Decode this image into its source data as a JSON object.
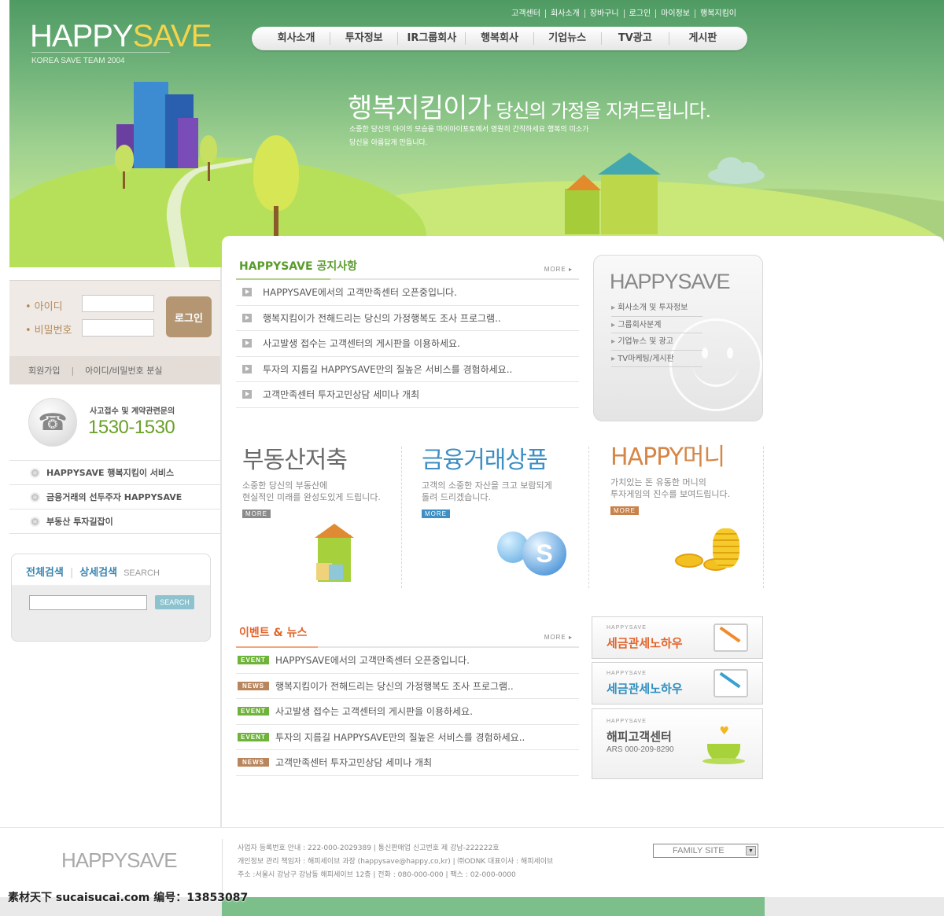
{
  "header": {
    "logo_happy": "HAPPY",
    "logo_save": "SAVE",
    "logo_sub": "KOREA SAVE TEAM 2004",
    "util_links": [
      "고객센터",
      "회사소개",
      "장바구니",
      "로그인",
      "마이정보",
      "행복지킴이"
    ],
    "nav": [
      "회사소개",
      "투자정보",
      "IR그룹회사",
      "행복회사",
      "기업뉴스",
      "TV광고",
      "게시판"
    ],
    "hero_title_big": "행복지킴이가",
    "hero_title_small": " 당신의 가정을 지켜드립니다.",
    "hero_desc_1": "소중한 당신의 아이의 모습을 마이아이포토에서 영원히 간직하세요   행복의 미소가",
    "hero_desc_2": "당신을 아름답게 만듭니다."
  },
  "login": {
    "id_label": "아이디",
    "pw_label": "비밀번호",
    "button": "로그인",
    "join": "회원가입",
    "sep": "|",
    "find": "아이디/비밀번호 분실"
  },
  "call": {
    "label": "사고접수 및 계약관련문의",
    "number": "1530-1530"
  },
  "side_menu": [
    "HAPPYSAVE 행복지킴이 서비스",
    "금융거래의 선두주자 HAPPYSAVE",
    "부동산 투자길잡이"
  ],
  "search": {
    "tab_all": "전체검색",
    "tab_detail": "상세검색",
    "tab_eng": "SEARCH",
    "button": "SEARCH"
  },
  "notice": {
    "title": "HAPPYSAVE 공지사항",
    "more": "MORE ▸",
    "items": [
      "HAPPYSAVE에서의 고객만족센터 오픈중입니다.",
      "행복지킴이가 전해드리는 당신의 가정행복도 조사 프로그램..",
      "사고발생 접수는 고객센터의 게시판을 이용하세요.",
      "투자의 지름길 HAPPYSAVE만의 질높은 서비스를 경험하세요..",
      "고객만족센터 투자고민상담 세미나 개최"
    ]
  },
  "promo": {
    "logo": "HAPPYSAVE",
    "links": [
      "회사소개 및 투자정보",
      "그룹회사분계",
      "기업뉴스 및 광고",
      "TV마케팅/게시판"
    ]
  },
  "products": [
    {
      "title": "부동산저축",
      "desc1": "소중한 당신의 부동산에",
      "desc2": "현실적인 미래를 완성도있게 드립니다.",
      "more": "MORE",
      "color": "#6b6b6b",
      "more_bg": "#8a8a8a"
    },
    {
      "title": "금융거래상품",
      "desc1": "고객의 소중한 자산을 크고 보람되게",
      "desc2": "돌려 드리겠습니다.",
      "more": "MORE",
      "color": "#3d8fc4",
      "more_bg": "#3d8fc4"
    },
    {
      "title": "HAPPY머니",
      "desc1": "가치있는 돈 유동한 머니의",
      "desc2": "투자게임의 진수를 보여드립니다.",
      "more": "MORE",
      "color": "#d58748",
      "more_bg": "#c9824a"
    }
  ],
  "events": {
    "title": "이벤트 & 뉴스",
    "more": "MORE ▸",
    "items": [
      {
        "tag": "EVENT",
        "type": "event",
        "text": "HAPPYSAVE에서의 고객만족센터 오픈중입니다."
      },
      {
        "tag": "NEWS",
        "type": "news",
        "text": "행복지킴이가 전해드리는 당신의 가정행복도 조사 프로그램.."
      },
      {
        "tag": "EVENT",
        "type": "event",
        "text": "사고발생 접수는 고객센터의 게시판을 이용하세요."
      },
      {
        "tag": "EVENT",
        "type": "event",
        "text": "투자의 지름길 HAPPYSAVE만의 질높은 서비스를 경험하세요.."
      },
      {
        "tag": "NEWS",
        "type": "news",
        "text": "고객만족센터 투자고민상담 세미나 개최"
      }
    ]
  },
  "banners": [
    {
      "brand": "HAPPYSAVE",
      "title": "세금관세노하우",
      "color": "#e2642a"
    },
    {
      "brand": "HAPPYSAVE",
      "title": "세금관세노하우",
      "color": "#2f8fc0"
    },
    {
      "brand": "HAPPYSAVE",
      "title": "해피고객센터",
      "sub": "ARS 000-209-8290",
      "color": "#555555"
    }
  ],
  "footer": {
    "logo": "HAPPYSAVE",
    "line1": "사업자 등록번호 안내 : 222-000-2029389 | 통신판매업 신고번호 제 강남-222222호",
    "line2": "개인정보 관리 책임자 : 해피세이브 과장 (happysave@happy,co,kr) | ㈜ODNK 대표이사 : 해피세이브",
    "line3": "주소 :서울시 강남구 강남동 해피세이브 12층 | 전화 : 080-000-000 | 팩스 : 02-000-0000",
    "family_site": "FAMILY SITE",
    "family_arrow": "▼"
  },
  "watermark": "素材天下 sucaisucai.com  编号：13853087"
}
